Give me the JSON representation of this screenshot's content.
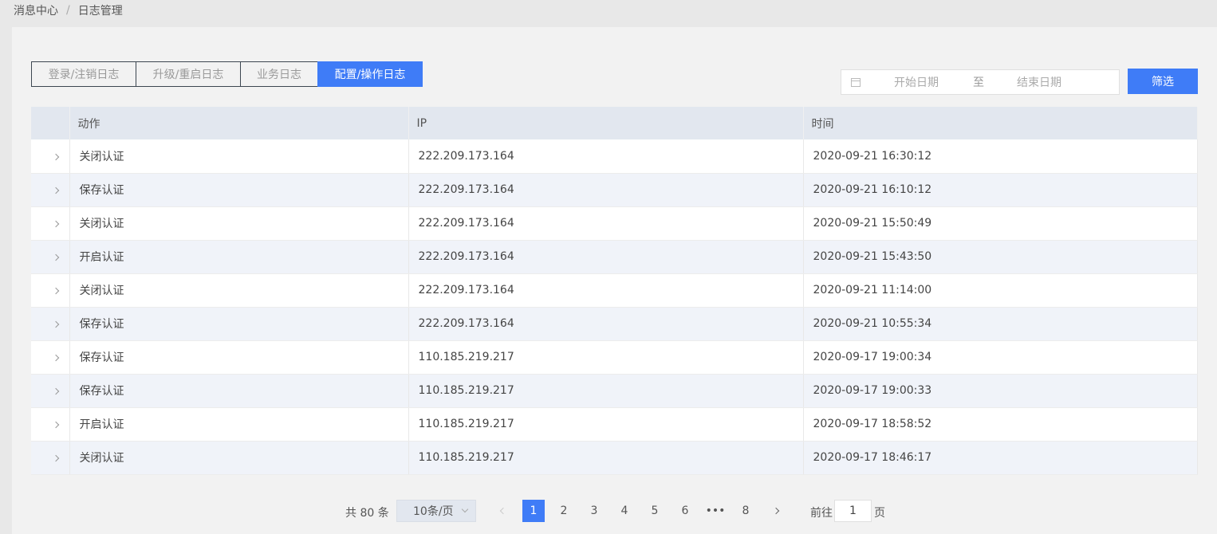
{
  "breadcrumb": [
    "消息中心",
    "日志管理"
  ],
  "breadcrumb_sep": "/",
  "tabs": [
    {
      "label": "登录/注销日志"
    },
    {
      "label": "升级/重启日志"
    },
    {
      "label": "业务日志"
    },
    {
      "label": "配置/操作日志"
    }
  ],
  "active_tab": 3,
  "filter": {
    "start_placeholder": "开始日期",
    "separator": "至",
    "end_placeholder": "结束日期",
    "button": "筛选"
  },
  "table": {
    "headers": [
      "动作",
      "IP",
      "时间"
    ],
    "rows": [
      {
        "action": "关闭认证",
        "ip": "222.209.173.164",
        "time": "2020-09-21 16:30:12"
      },
      {
        "action": "保存认证",
        "ip": "222.209.173.164",
        "time": "2020-09-21 16:10:12"
      },
      {
        "action": "关闭认证",
        "ip": "222.209.173.164",
        "time": "2020-09-21 15:50:49"
      },
      {
        "action": "开启认证",
        "ip": "222.209.173.164",
        "time": "2020-09-21 15:43:50"
      },
      {
        "action": "关闭认证",
        "ip": "222.209.173.164",
        "time": "2020-09-21 11:14:00"
      },
      {
        "action": "保存认证",
        "ip": "222.209.173.164",
        "time": "2020-09-21 10:55:34"
      },
      {
        "action": "保存认证",
        "ip": "110.185.219.217",
        "time": "2020-09-17 19:00:34"
      },
      {
        "action": "保存认证",
        "ip": "110.185.219.217",
        "time": "2020-09-17 19:00:33"
      },
      {
        "action": "开启认证",
        "ip": "110.185.219.217",
        "time": "2020-09-17 18:58:52"
      },
      {
        "action": "关闭认证",
        "ip": "110.185.219.217",
        "time": "2020-09-17 18:46:17"
      }
    ]
  },
  "pagination": {
    "total_text": "共 80 条",
    "page_size": "10条/页",
    "pages": [
      "1",
      "2",
      "3",
      "4",
      "5",
      "6",
      "•••",
      "8"
    ],
    "current": "1",
    "goto_label": "前往",
    "goto_value": "1",
    "goto_suffix": "页"
  },
  "colors": {
    "accent": "#3f7cf7",
    "header_bg": "#e2e7ef",
    "stripe_bg": "#f0f3f9"
  }
}
